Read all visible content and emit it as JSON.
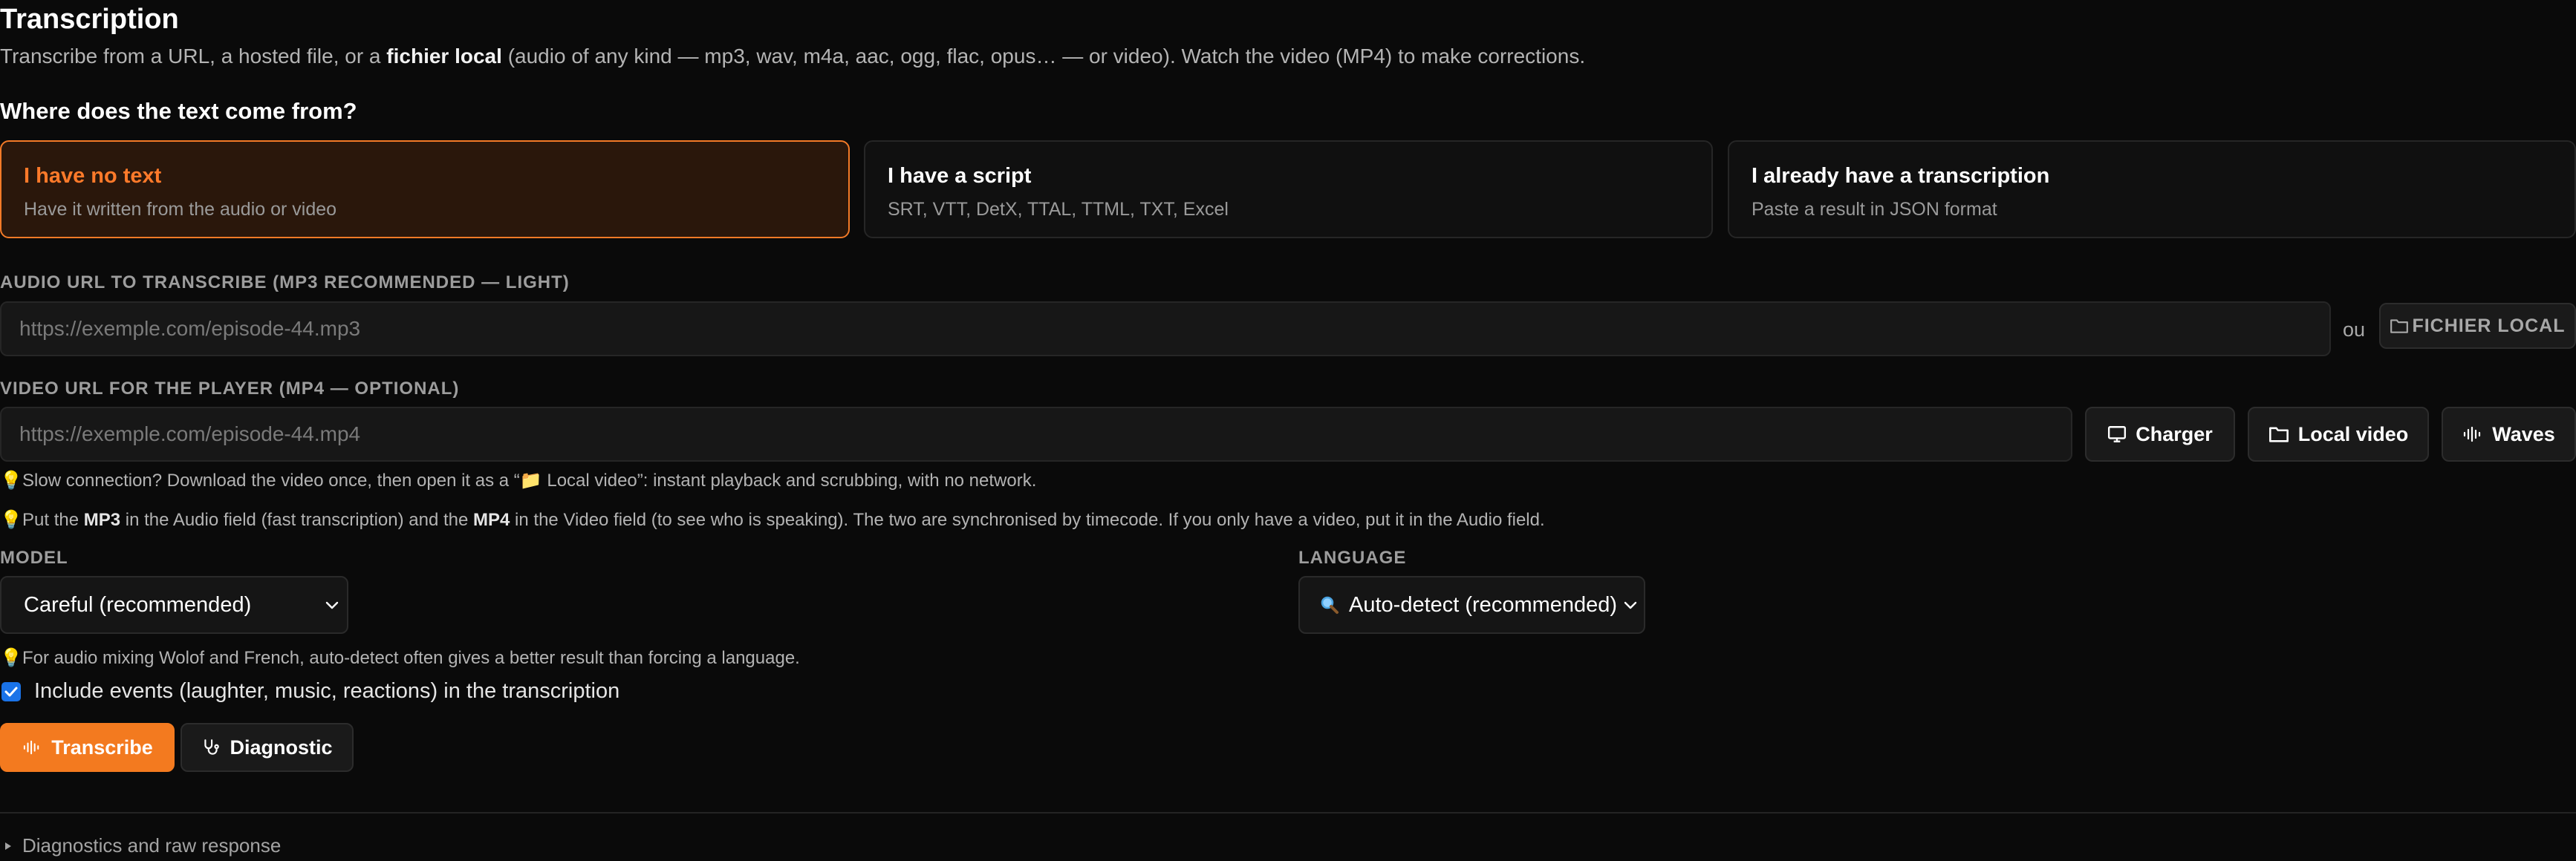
{
  "page": {
    "title": "Transcription",
    "subtitle_prefix": "Transcribe from a URL, a hosted file, or a ",
    "subtitle_bold": "fichier local",
    "subtitle_suffix": " (audio of any kind — mp3, wav, m4a, aac, ogg, flac, opus… — or video). Watch the video (MP4) to make corrections."
  },
  "source": {
    "question": "Where does the text come from?",
    "options": [
      {
        "title": "I have no text",
        "desc": "Have it written from the audio or video",
        "selected": true
      },
      {
        "title": "I have a script",
        "desc": "SRT, VTT, DetX, TTAL, TTML, TXT, Excel",
        "selected": false
      },
      {
        "title": "I already have a transcription",
        "desc": "Paste a result in JSON format",
        "selected": false
      }
    ]
  },
  "audio": {
    "label": "AUDIO URL TO TRANSCRIBE (MP3 RECOMMENDED — LIGHT)",
    "placeholder": "https://exemple.com/episode-44.mp3",
    "value": "",
    "or": "ou",
    "local_file_label": "FICHIER LOCAL",
    "local_file_icon": "folder-icon"
  },
  "video": {
    "label": "VIDEO URL FOR THE PLAYER (MP4 — OPTIONAL)",
    "placeholder": "https://exemple.com/episode-44.mp4",
    "value": "",
    "load_label": "Charger",
    "load_icon": "monitor-icon",
    "local_video_label": "Local video",
    "local_video_icon": "folder-icon",
    "waves_label": "Waves",
    "waves_icon": "waveform-icon"
  },
  "hints": {
    "icon": "lightbulb-icon",
    "slow_connection_prefix": "Slow connection? Download the video once, then open it as a “",
    "slow_connection_emoji": "📁",
    "slow_connection_suffix": " Local video”: instant playback and scrubbing, with no network.",
    "sync_1": "Put the ",
    "sync_mp3": "MP3",
    "sync_2": " in the Audio field (fast transcription) and the ",
    "sync_mp4": "MP4",
    "sync_3": " in the Video field (to see who is speaking). The two are synchronised by timecode. If you only have a video, put it in the Audio field.",
    "language_hint": "For audio mixing Wolof and French, auto-detect often gives a better result than forcing a language."
  },
  "model": {
    "label": "MODEL",
    "selected": "Careful (recommended)"
  },
  "language": {
    "label": "LANGUAGE",
    "icon": "magnifier-icon",
    "selected": "Auto-detect (recommended)"
  },
  "events": {
    "checked": true,
    "label": "Include events (laughter, music, reactions) in the transcription"
  },
  "actions": {
    "transcribe_label": "Transcribe",
    "transcribe_icon": "waveform-icon",
    "diagnostic_label": "Diagnostic",
    "diagnostic_icon": "stethoscope-icon"
  },
  "details": {
    "summary": "Diagnostics and raw response"
  },
  "colors": {
    "accent": "#f37a1f",
    "background": "#0a0a0a",
    "selected_card_bg": "#2a170b",
    "checkbox": "#1a73e8"
  }
}
